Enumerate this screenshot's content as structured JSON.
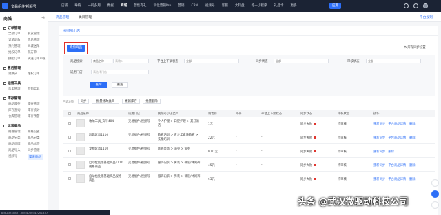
{
  "topbar": {
    "store": "交易组件/视频号",
    "nav": [
      "店铺",
      "导购",
      "一码多用",
      "数据",
      "商城",
      "营售有礼",
      "私位营销Pro",
      "营销",
      "CRM",
      "视频号",
      "客服",
      "大转盘",
      "等一小程序",
      "礼品卡",
      "更多"
    ],
    "active_index": 4,
    "app_button": "应用"
  },
  "sidebar": {
    "title": "商城",
    "collapse": "≪",
    "sections": [
      {
        "label": "订单管理",
        "items": [
          [
            "全部订单",
            "发货管理"
          ],
          [
            "订单退款",
            "售后管理"
          ],
          [
            "预约管理",
            "同城送单"
          ],
          [
            "维权订单",
            "礼方单"
          ],
          [
            "拼团订单",
            "满送订单审核"
          ]
        ]
      },
      {
        "label": "售后管理",
        "items": [
          [
            "退换货",
            "维权订单"
          ]
        ]
      },
      {
        "label": "运营工具",
        "items": [
          [
            "售卖管理",
            "营销工具"
          ]
        ]
      },
      {
        "label": "库存管理",
        "items": [
          [
            "商品库存",
            "库存管理"
          ],
          [
            "库存查询",
            "库存统计"
          ],
          [
            "仓库管理",
            "库存预警"
          ]
        ]
      },
      {
        "label": "运营商品",
        "items": [
          [
            "规格管理",
            "规格设置"
          ],
          [
            "商品分类",
            "商品分类"
          ],
          [
            "商品品牌",
            "商品标签"
          ],
          [
            "商品导入",
            "同步管理"
          ],
          [
            "视频号",
            "渠道商品"
          ]
        ]
      }
    ],
    "active_item": "渠道商品"
  },
  "tabs": {
    "items": [
      "商品管理",
      "类目管理"
    ],
    "right": "平台规则"
  },
  "card": {
    "subtab": "视频号小店",
    "add_button": "添加商品",
    "sync_settings": "库存同步设置",
    "filter": {
      "product_search_label": "商品搜索",
      "product_name": "商品名称",
      "product_placeholder": "请输入",
      "platform_status_label": "平台上下架状态",
      "platform_status_value": "全部",
      "sync_status_label": "同步状态",
      "sync_status_value": "全部",
      "review_status_label": "审核状态",
      "review_status_value": "全部",
      "store_label": "适用门店",
      "store_placeholder": "请选择门店",
      "query": "查询",
      "reset": "重置"
    },
    "bulk": {
      "selected": "已选0项",
      "buttons": [
        "同步",
        "批量修改类目",
        "更新库存",
        "批量删除"
      ]
    },
    "table": {
      "headers": [
        "商品名称",
        "适用门店",
        "视频号小店类目",
        "销售价",
        "库存",
        "平台上下架状态",
        "同步状态",
        "审核状态",
        "操作"
      ],
      "rows": [
        {
          "name": "收纳工具_货号404",
          "store": "交易组件/视频号",
          "category": "个人护理 > 口腔护理 > 其牙清洁",
          "price": "1元",
          "stock": "-",
          "platform": "-",
          "sync": "同步失败",
          "review": "待审核",
          "actions": [
            "重新同步",
            "平台商品详情",
            "删除"
          ]
        },
        {
          "name": "玩偶玩具1110",
          "store": "交易组件/视频号",
          "category": "教育培训 > 青少年素质教育 > 技能培训",
          "price": "22元",
          "stock": "-",
          "platform": "-",
          "sync": "同步失败",
          "review": "待审核",
          "actions": [
            "重新同步",
            "平台商品详情",
            "删除"
          ]
        },
        {
          "name": "宠物玩具1110",
          "store": "交易组件/视频号",
          "category": "装修装饰 > 海参 > 海参",
          "price": "0.01元",
          "stock": "-",
          "platform": "-",
          "sync": "同步失败",
          "review": "待审核",
          "actions": [
            "重新同步",
            "删除"
          ]
        },
        {
          "name": "自动化处理基础商品1110规格商品",
          "store": "交易组件/视频号",
          "category": "服饰内衣 > 男装 > 裤装/休闲裤",
          "price": "45元",
          "stock": "-",
          "platform": "-",
          "sync": "同步失败",
          "review": "待审核",
          "actions": [
            "重新同步",
            "平台商品详情",
            "删除"
          ]
        },
        {
          "name": "自动化处理基础商品规格商品",
          "store": "交易组件/视频号",
          "category": "服饰内衣 > 男装 > 裤装/休闲裤",
          "price": "45元",
          "stock": "-",
          "platform": "-",
          "sync": "同步失败",
          "review": "待审核",
          "actions": [
            "重新同步",
            "平台商品详情",
            "删除"
          ]
        }
      ]
    }
  },
  "footer": "pid:23740837, vid:4000342261837",
  "watermark": "头条 @武汉微驱动科技公司"
}
